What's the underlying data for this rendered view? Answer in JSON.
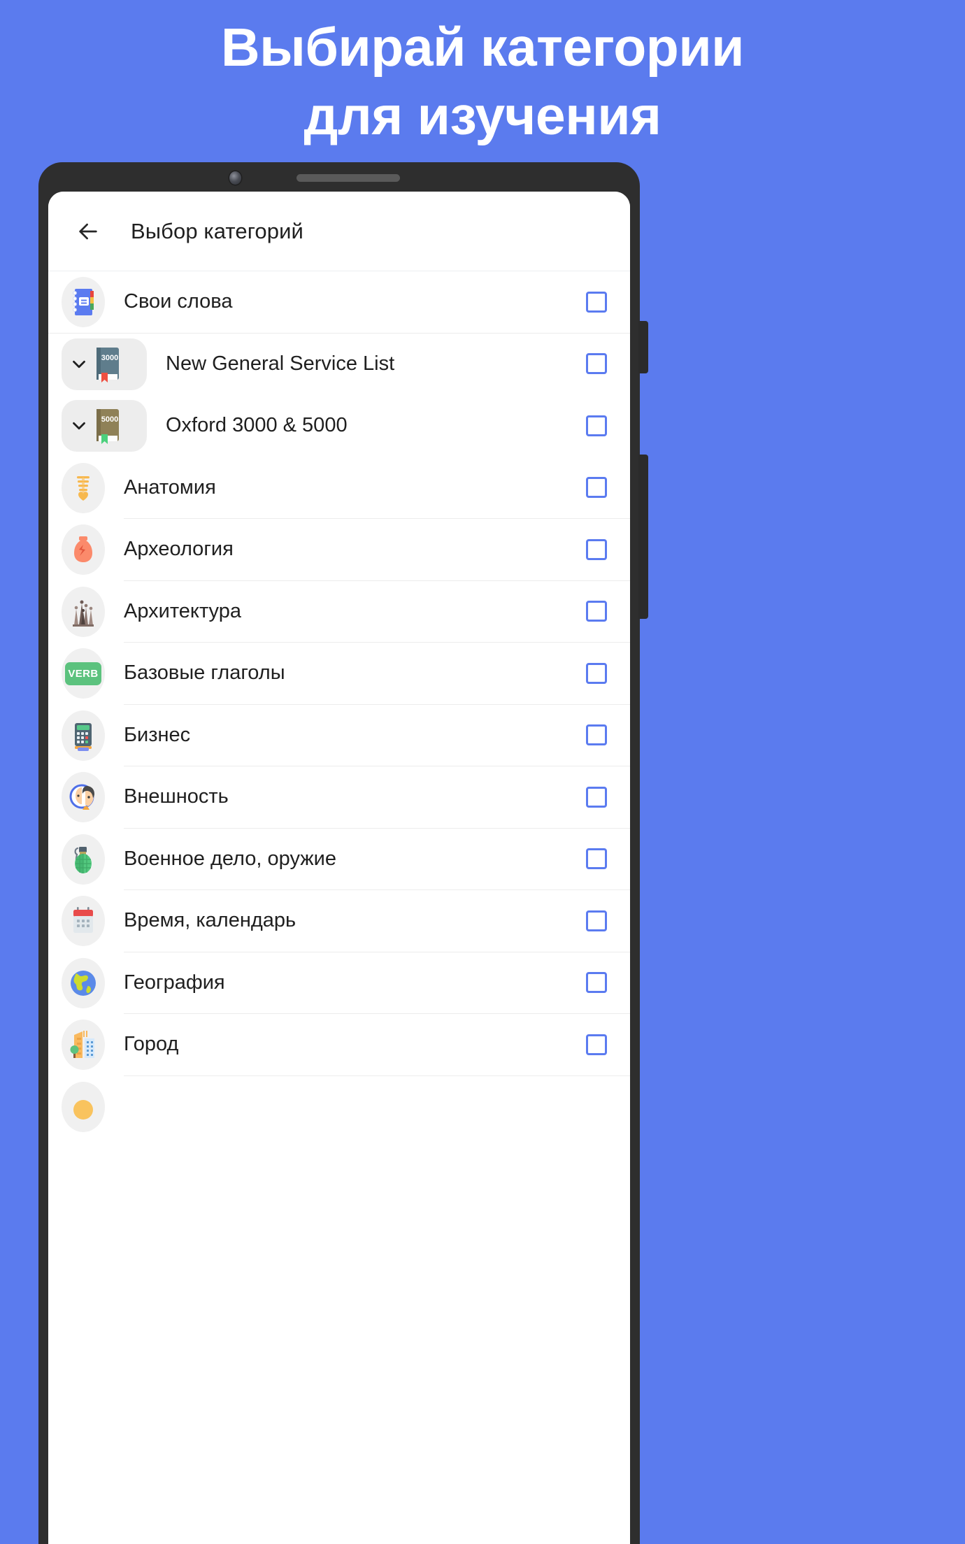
{
  "headline": {
    "line1": "Выбирай категории",
    "line2": "для изучения"
  },
  "colors": {
    "background": "#5b7bee",
    "bezel": "#2e2e2e",
    "checkbox_border": "#5b7bf0",
    "verb_badge": "#5cc27e",
    "icon_bg": "#f0f0f0",
    "divider": "#ececec",
    "text": "#1f1f1f"
  },
  "device": {
    "camera": "front-camera",
    "speaker": "earpiece-speaker"
  },
  "toolbar": {
    "back_icon": "arrow-left-icon",
    "title": "Выбор категорий"
  },
  "list": {
    "rows": [
      {
        "label": "Свои слова",
        "icon": "notebook-icon",
        "expandable": false,
        "checked": false
      },
      {
        "label": "New General Service List",
        "icon": "book-3000-icon",
        "expandable": true,
        "checked": false,
        "book_number": "3000"
      },
      {
        "label": "Oxford 3000 & 5000",
        "icon": "book-5000-icon",
        "expandable": true,
        "checked": false,
        "book_number": "5000"
      },
      {
        "label": "Анатомия",
        "icon": "spine-icon",
        "expandable": false,
        "checked": false
      },
      {
        "label": "Археология",
        "icon": "amphora-icon",
        "expandable": false,
        "checked": false
      },
      {
        "label": "Архитектура",
        "icon": "cathedral-icon",
        "expandable": false,
        "checked": false
      },
      {
        "label": "Базовые глаголы",
        "icon": "verb-badge-icon",
        "expandable": false,
        "checked": false,
        "badge_text": "VERB"
      },
      {
        "label": "Бизнес",
        "icon": "pos-terminal-icon",
        "expandable": false,
        "checked": false
      },
      {
        "label": "Внешность",
        "icon": "face-mirror-icon",
        "expandable": false,
        "checked": false
      },
      {
        "label": "Военное дело, оружие",
        "icon": "grenade-icon",
        "expandable": false,
        "checked": false
      },
      {
        "label": "Время, календарь",
        "icon": "calendar-icon",
        "expandable": false,
        "checked": false
      },
      {
        "label": "География",
        "icon": "globe-icon",
        "expandable": false,
        "checked": false
      },
      {
        "label": "Город",
        "icon": "city-icon",
        "expandable": false,
        "checked": false
      },
      {
        "label": "",
        "icon": "partial-icon",
        "expandable": false,
        "checked": false
      }
    ],
    "chevron_icon": "chevron-down-icon",
    "checkbox_icon": "checkbox-unchecked-icon"
  }
}
